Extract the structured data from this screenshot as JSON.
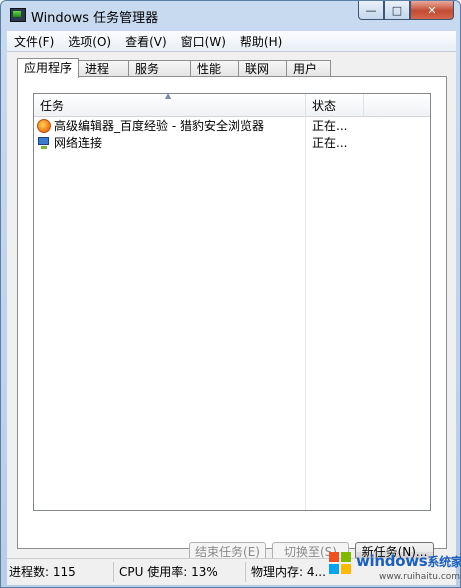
{
  "window": {
    "title": "Windows 任务管理器",
    "controls": {
      "minimize": "—",
      "maximize": "□",
      "close": "✕"
    }
  },
  "menubar": {
    "items": [
      {
        "label": "文件(F)"
      },
      {
        "label": "选项(O)"
      },
      {
        "label": "查看(V)"
      },
      {
        "label": "窗口(W)"
      },
      {
        "label": "帮助(H)"
      }
    ]
  },
  "tabs": [
    {
      "label": "应用程序",
      "active": true
    },
    {
      "label": "进程"
    },
    {
      "label": "服务"
    },
    {
      "label": "性能"
    },
    {
      "label": "联网"
    },
    {
      "label": "用户"
    }
  ],
  "task_list": {
    "columns": {
      "task": "任务",
      "status": "状态"
    },
    "rows": [
      {
        "task": "高级编辑器_百度经验 - 猎豹安全浏览器",
        "status": "正在...",
        "icon": "browser-icon"
      },
      {
        "task": "网络连接",
        "status": "正在...",
        "icon": "network-icon"
      }
    ]
  },
  "buttons": {
    "end_task": "结束任务(E)",
    "switch_to": "切换至(S)",
    "new_task": "新任务(N)..."
  },
  "statusbar": {
    "processes": "进程数: 115",
    "cpu": "CPU 使用率: 13%",
    "memory": "物理内存: 4..."
  },
  "watermark": {
    "brand": "windows",
    "suffix": "系统家园",
    "url": "www.ruihaitu.com"
  }
}
